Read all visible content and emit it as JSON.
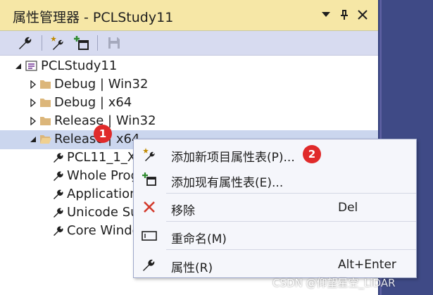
{
  "panel": {
    "title": "属性管理器 - PCLStudy11",
    "title_buttons": [
      "▼",
      "⊓",
      "✕"
    ]
  },
  "toolbar": {
    "icons": [
      "wrench-icon",
      "add-new-property-sheet-icon",
      "add-existing-property-sheet-icon",
      "save-icon"
    ]
  },
  "tree": {
    "root": "PCLStudy11",
    "configs": [
      {
        "label": "Debug | Win32",
        "expanded": false
      },
      {
        "label": "Debug | x64",
        "expanded": false
      },
      {
        "label": "Release | Win32",
        "expanded": false
      },
      {
        "label": "Release | x64",
        "expanded": true,
        "selected": true
      }
    ],
    "sheets": [
      "PCL11_1_X",
      "Whole Prog",
      "Application",
      "Unicode Su",
      "Core Windo"
    ]
  },
  "menu": {
    "items": [
      {
        "label": "添加新项目属性表(P)...",
        "shortcut": ""
      },
      {
        "label": "添加现有属性表(E)...",
        "shortcut": ""
      },
      {
        "label": "移除",
        "shortcut": "Del"
      },
      {
        "label": "重命名(M)",
        "shortcut": ""
      },
      {
        "label": "属性(R)",
        "shortcut": "Alt+Enter"
      }
    ]
  },
  "annotations": {
    "badge1": "1",
    "badge2": "2"
  },
  "watermark": "CSDN @仰望星空_LiDAR",
  "colors": {
    "title_bg": "#f6e7a6",
    "toolbar_bg": "#d7dbf0",
    "selected_bg": "#cbd6ee",
    "badge": "#e02a2a",
    "remove_red": "#d33a2c",
    "ide_bg": "#3f4a86"
  }
}
